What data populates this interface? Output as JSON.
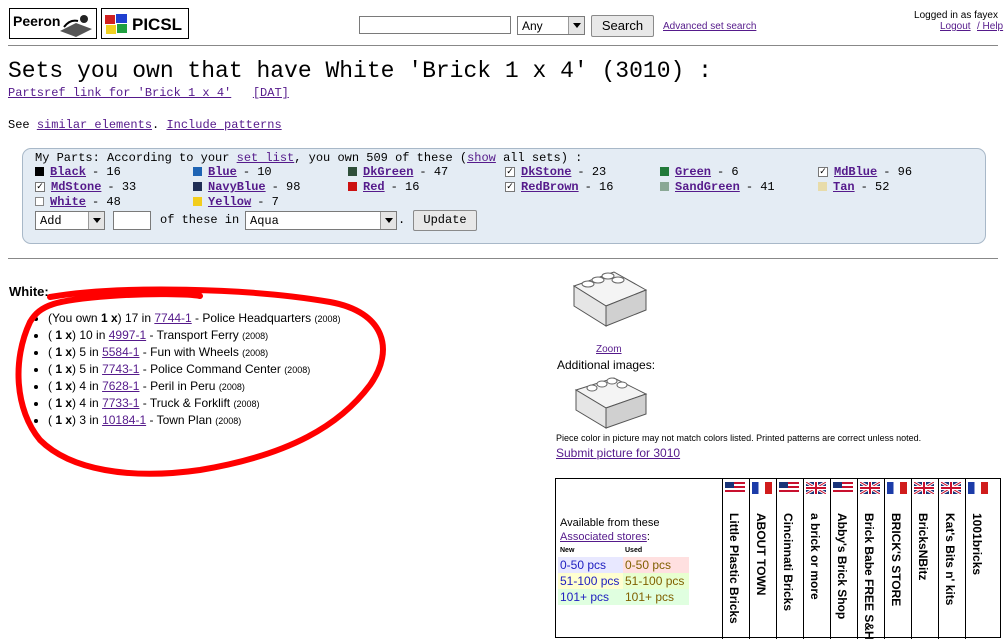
{
  "header": {
    "logo1_text": "Peeron",
    "logo2_text": "PICSL",
    "search_value": "",
    "search_scope": "Any",
    "search_button": "Search",
    "advanced_link": "Advanced set search",
    "logged_in": "Logged in as fayex",
    "logout": "Logout",
    "help": "/ Help"
  },
  "page": {
    "title": "Sets you own that have White 'Brick 1 x 4' (3010) :",
    "partsref_link": "Partsref link for 'Brick 1 x 4'",
    "dat_link": "[DAT]",
    "see_prefix": "See",
    "similar_link": "similar elements",
    "period": ".",
    "include_patterns": "Include patterns"
  },
  "my_parts": {
    "intro_prefix": "My Parts: According to your",
    "set_list_link": "set list",
    "intro_mid": ", you own 509 of these (",
    "show_link": "show",
    "intro_suffix": "all sets) :",
    "colors": [
      {
        "name": "Black",
        "count": "- 16",
        "swatch": "#000000",
        "checked": false
      },
      {
        "name": "Blue",
        "count": "- 10",
        "swatch": "#1e64b4",
        "checked": false
      },
      {
        "name": "DkGreen",
        "count": "- 47",
        "swatch": "#2f4f3a",
        "checked": false
      },
      {
        "name": "DkStone",
        "count": "- 23",
        "swatch": "#ffffff",
        "checked": true
      },
      {
        "name": "Green",
        "count": "- 6",
        "swatch": "#227a3a",
        "checked": false
      },
      {
        "name": "MdBlue",
        "count": "- 96",
        "swatch": "#ffffff",
        "checked": true
      },
      {
        "name": "MdStone",
        "count": "- 33",
        "swatch": "#ffffff",
        "checked": true
      },
      {
        "name": "NavyBlue",
        "count": "- 98",
        "swatch": "#1f2e55",
        "checked": false
      },
      {
        "name": "Red",
        "count": "- 16",
        "swatch": "#cc1010",
        "checked": false
      },
      {
        "name": "RedBrown",
        "count": "- 16",
        "swatch": "#ffffff",
        "checked": true
      },
      {
        "name": "SandGreen",
        "count": "- 41",
        "swatch": "#8aa895",
        "checked": false
      },
      {
        "name": "Tan",
        "count": "- 52",
        "swatch": "#e8dcaa",
        "checked": false
      },
      {
        "name": "White",
        "count": "- 48",
        "swatch": "#ffffff",
        "checked": false
      },
      {
        "name": "Yellow",
        "count": "- 7",
        "swatch": "#f2cd1c",
        "checked": false
      }
    ],
    "action_select": "Add",
    "quantity_value": "",
    "of_these_in": "of these in",
    "color_select": "Aqua",
    "dot": ".",
    "update_button": "Update"
  },
  "white_section": {
    "heading": "White:",
    "sets": [
      {
        "own": "(You own ",
        "qty": "1 x",
        "close": ") ",
        "count": "17 in",
        "set_no": "7744-1",
        "name": " - Police Headquarters ",
        "year": "(2008)"
      },
      {
        "own": "( ",
        "qty": "1 x",
        "close": ") ",
        "count": "10 in",
        "set_no": "4997-1",
        "name": " - Transport Ferry ",
        "year": "(2008)"
      },
      {
        "own": "( ",
        "qty": "1 x",
        "close": ") ",
        "count": "5 in",
        "set_no": "5584-1",
        "name": " - Fun with Wheels ",
        "year": "(2008)"
      },
      {
        "own": "( ",
        "qty": "1 x",
        "close": ") ",
        "count": "5 in",
        "set_no": "7743-1",
        "name": " - Police Command Center ",
        "year": "(2008)"
      },
      {
        "own": "( ",
        "qty": "1 x",
        "close": ") ",
        "count": "4 in",
        "set_no": "7628-1",
        "name": " - Peril in Peru ",
        "year": "(2008)"
      },
      {
        "own": "( ",
        "qty": "1 x",
        "close": ") ",
        "count": "4 in",
        "set_no": "7733-1",
        "name": " - Truck & Forklift ",
        "year": "(2008)"
      },
      {
        "own": "( ",
        "qty": "1 x",
        "close": ") ",
        "count": "3 in",
        "set_no": "10184-1",
        "name": " - Town Plan ",
        "year": "(2008)"
      }
    ]
  },
  "images": {
    "zoom": "Zoom",
    "additional": "Additional images:",
    "note": "Piece color in picture may not match colors listed. Printed patterns are correct unless noted.",
    "submit": "Submit picture for 3010"
  },
  "stores": {
    "available": "Available from these",
    "associated": "Associated stores",
    "colon": ":",
    "new_label": "New",
    "used_label": "Used",
    "ranges": [
      {
        "new": "0-50 pcs",
        "used": "0-50 pcs",
        "new_bg": "#e8e8ff",
        "used_bg": "#ffe0e0",
        "new_color": "#2020c0",
        "used_color": "#806000"
      },
      {
        "new": "51-100 pcs",
        "used": "51-100 pcs",
        "new_bg": "#ffffd0",
        "used_bg": "#e8ffd0",
        "new_color": "#2020c0",
        "used_color": "#806000"
      },
      {
        "new": "101+ pcs",
        "used": "101+ pcs",
        "new_bg": "#e0ffe0",
        "used_bg": "#e0ffe0",
        "new_color": "#2020c0",
        "used_color": "#806000"
      }
    ],
    "list": [
      {
        "name": "Little Plastic Bricks",
        "flag": "us"
      },
      {
        "name": "ABOUT TOWN",
        "flag": "fr"
      },
      {
        "name": "Cincinnati Bricks",
        "flag": "us"
      },
      {
        "name": "a brick or more",
        "flag": "uk"
      },
      {
        "name": "Abby's Brick Shop",
        "flag": "us"
      },
      {
        "name": "Brick Babe FREE S&H",
        "flag": "uk"
      },
      {
        "name": "BRICK'S STORE",
        "flag": "fr"
      },
      {
        "name": "BricksNBitz",
        "flag": "uk"
      },
      {
        "name": "Kat's Bits n' kits",
        "flag": "uk"
      },
      {
        "name": "1001bricks",
        "flag": "fr"
      }
    ]
  }
}
